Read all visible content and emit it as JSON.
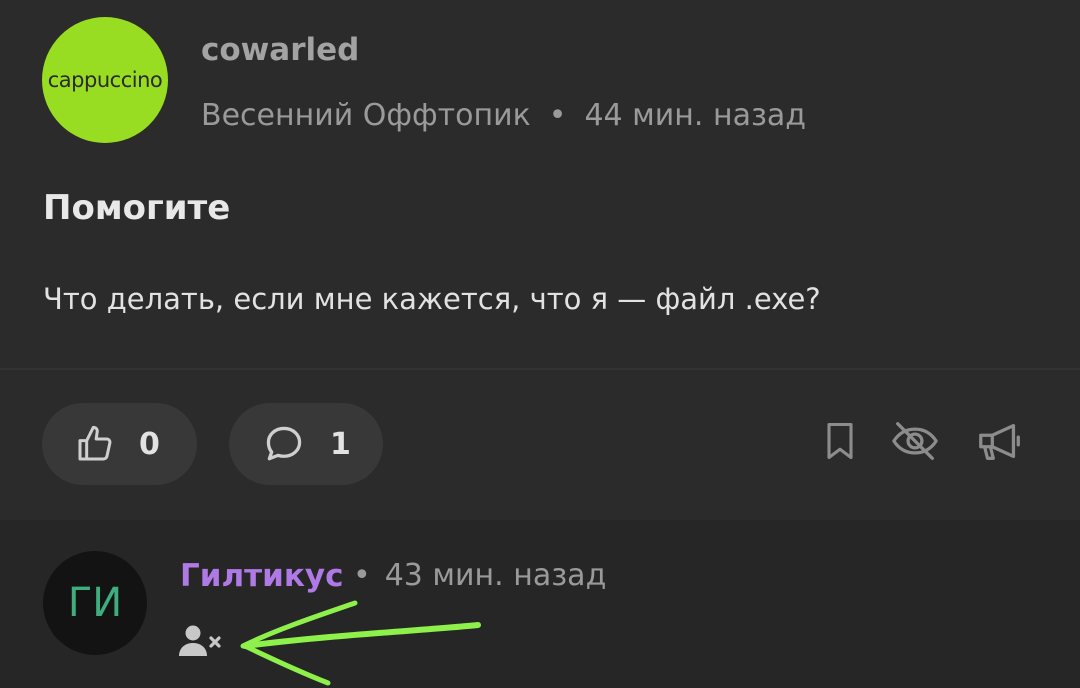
{
  "post": {
    "avatar_text": "cappuccino",
    "author": "cowarled",
    "community": "Весенний Оффтопик",
    "separator": "•",
    "time": "44 мин. назад",
    "title": "Помогите",
    "body": "Что делать, если мне кажется, что я — файл .exe?",
    "likes": "0",
    "comments": "1"
  },
  "icons": {
    "like": "thumb-up-icon",
    "comment": "speech-bubble-icon",
    "bookmark": "bookmark-icon",
    "hide": "eye-slash-icon",
    "promote": "megaphone-icon",
    "blocked": "user-blocked-icon"
  },
  "comment": {
    "avatar_initials": "ГИ",
    "author": "Гилтикус",
    "separator": "•",
    "time": "43 мин. назад"
  },
  "colors": {
    "background": "#262626",
    "post_card": "#2b2b2b",
    "avatar_post": "#99dd22",
    "comment_author": "#b07ae6",
    "annotation_arrow": "#8ef04a"
  }
}
